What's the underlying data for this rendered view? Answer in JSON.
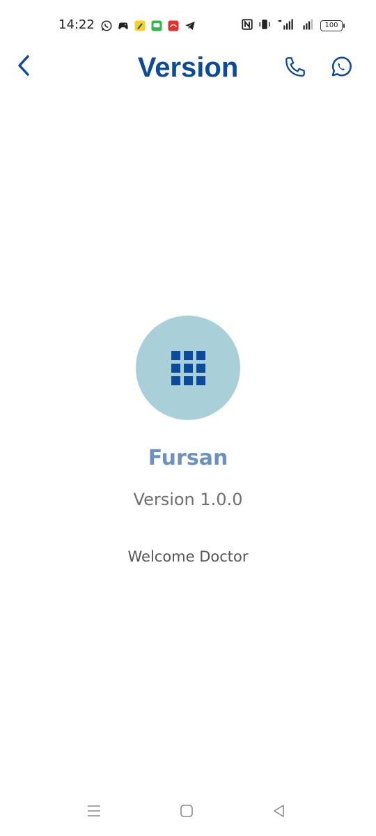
{
  "status_bar": {
    "time": "14:22",
    "battery": "100",
    "left_icons": [
      "whatsapp-icon",
      "game-controller-icon",
      "pencil-app-icon",
      "messages-icon",
      "mail-app-icon",
      "telegram-icon"
    ],
    "right_icons": [
      "nfc-icon",
      "vibrate-icon",
      "signal-icon",
      "signal-icon-2",
      "battery-icon"
    ]
  },
  "header": {
    "title": "Version",
    "back_icon": "chevron-left-icon",
    "phone_icon": "phone-icon",
    "whatsapp_icon": "whatsapp-icon"
  },
  "main": {
    "app_name": "Fursan",
    "version": "Version 1.0.0",
    "welcome": "Welcome Doctor",
    "logo_icon": "grid-apps-icon"
  },
  "nav_bar": {
    "icons": [
      "menu-icon",
      "home-icon",
      "back-triangle-icon"
    ]
  },
  "colors": {
    "primary": "#0c4a9c",
    "app_name": "#6a91c0",
    "logo_bg": "#a9d0d8",
    "muted_text": "#6e6e6e"
  }
}
